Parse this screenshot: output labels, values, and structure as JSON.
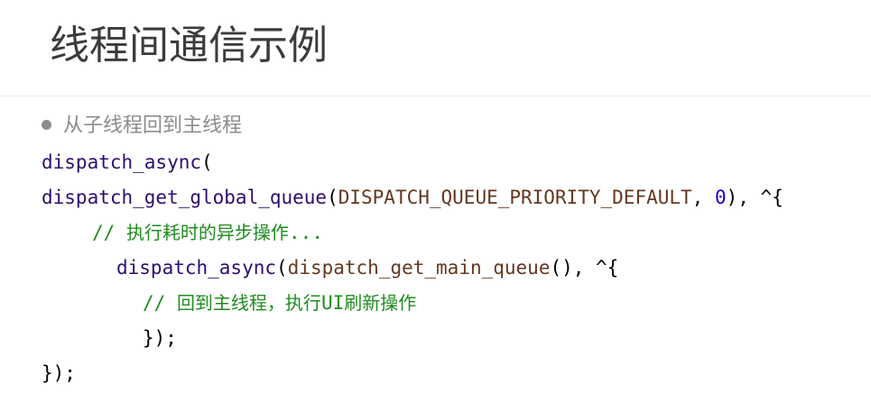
{
  "slide": {
    "title": "线程间通信示例"
  },
  "bullet": {
    "text": "从子线程回到主线程"
  },
  "code": {
    "line1": {
      "fn": "dispatch_async",
      "open": "("
    },
    "line2": {
      "fn": "dispatch_get_global_queue",
      "open": "(",
      "macro": "DISPATCH_QUEUE_PRIORITY_DEFAULT",
      "comma": ", ",
      "num": "0",
      "close": "), ^{"
    },
    "line3": {
      "slashes": "// ",
      "text": "执行耗时的异步操作",
      "dots": "..."
    },
    "line4": {
      "fn": "dispatch_async",
      "open": "(",
      "macro": "dispatch_get_main_queue",
      "close": "(), ^{"
    },
    "line5": {
      "slashes": "// ",
      "text1": "回到主线程，执行",
      "ui": "UI",
      "text2": "刷新操作"
    },
    "line6": {
      "text": "});"
    },
    "line7": {
      "text": "});"
    }
  },
  "colors": {
    "function": "#2e0d6e",
    "macro": "#643820",
    "number": "#1c00cf",
    "comment": "#1f8c1f",
    "title": "#3b3b3b",
    "bullet": "#8c8c8c"
  }
}
